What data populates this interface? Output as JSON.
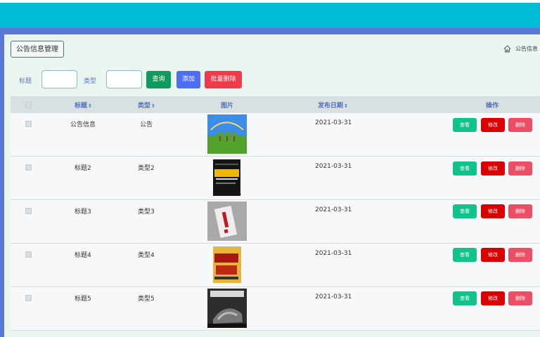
{
  "page": {
    "title_button": "公告信息管理",
    "breadcrumb": "公告信息"
  },
  "search": {
    "title_label": "标题",
    "type_label": "类型",
    "title_value": "",
    "type_value": "",
    "query_label": "查询",
    "add_label": "添加",
    "batch_delete_label": "批量删除"
  },
  "table": {
    "headers": {
      "title": "标题",
      "type": "类型",
      "image": "图片",
      "date": "发布日期",
      "actions": "操作"
    },
    "rows": [
      {
        "title": "公告信息",
        "type": "公告",
        "date": "2021-03-31",
        "image": "landscape"
      },
      {
        "title": "标题2",
        "type": "类型2",
        "date": "2021-03-31",
        "image": "management-book"
      },
      {
        "title": "标题3",
        "type": "类型3",
        "date": "2021-03-31",
        "image": "red-book"
      },
      {
        "title": "标题4",
        "type": "类型4",
        "date": "2021-03-31",
        "image": "yellow-book"
      },
      {
        "title": "标题5",
        "type": "类型5",
        "date": "2021-03-31",
        "image": "fitness-book"
      }
    ],
    "actions": {
      "view": "查看",
      "edit": "修改",
      "delete": "删除"
    }
  },
  "icons": {
    "breadcrumb": "home-icon",
    "sort": "sort-icon"
  },
  "colors": {
    "topbar": "#00bcd4",
    "frame": "#5a77d6",
    "content": "#e9f5ee",
    "query": "#0f9a60",
    "add": "#4c6ef5",
    "batch_delete": "#ef3b49"
  }
}
